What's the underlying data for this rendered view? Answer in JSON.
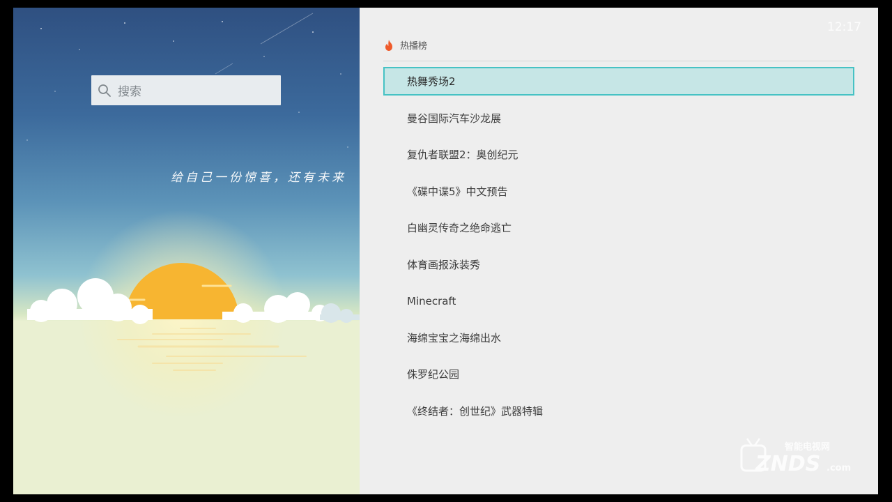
{
  "search": {
    "placeholder": "搜索"
  },
  "banner": {
    "slogan": "给自己一份惊喜，还有未来"
  },
  "clock": "12:17",
  "hot_list": {
    "title": "热播榜",
    "items": [
      "热舞秀场2",
      "曼谷国际汽车沙龙展",
      "复仇者联盟2：奥创纪元",
      "《碟中谍5》中文预告",
      "白幽灵传奇之绝命逃亡",
      "体育画报泳装秀",
      "Minecraft",
      "海绵宝宝之海绵出水",
      "侏罗纪公园",
      "《终结者：创世纪》武器特辑"
    ],
    "focused_index": 0
  },
  "watermark": {
    "brand": "ZNDS",
    "tagline": "智能电视网",
    "domain": ".com"
  },
  "colors": {
    "focus_bg": "#c6e6e6",
    "focus_border": "#46c2c4",
    "panel_bg": "#eeeeee",
    "flame": "#ef5a2a"
  }
}
